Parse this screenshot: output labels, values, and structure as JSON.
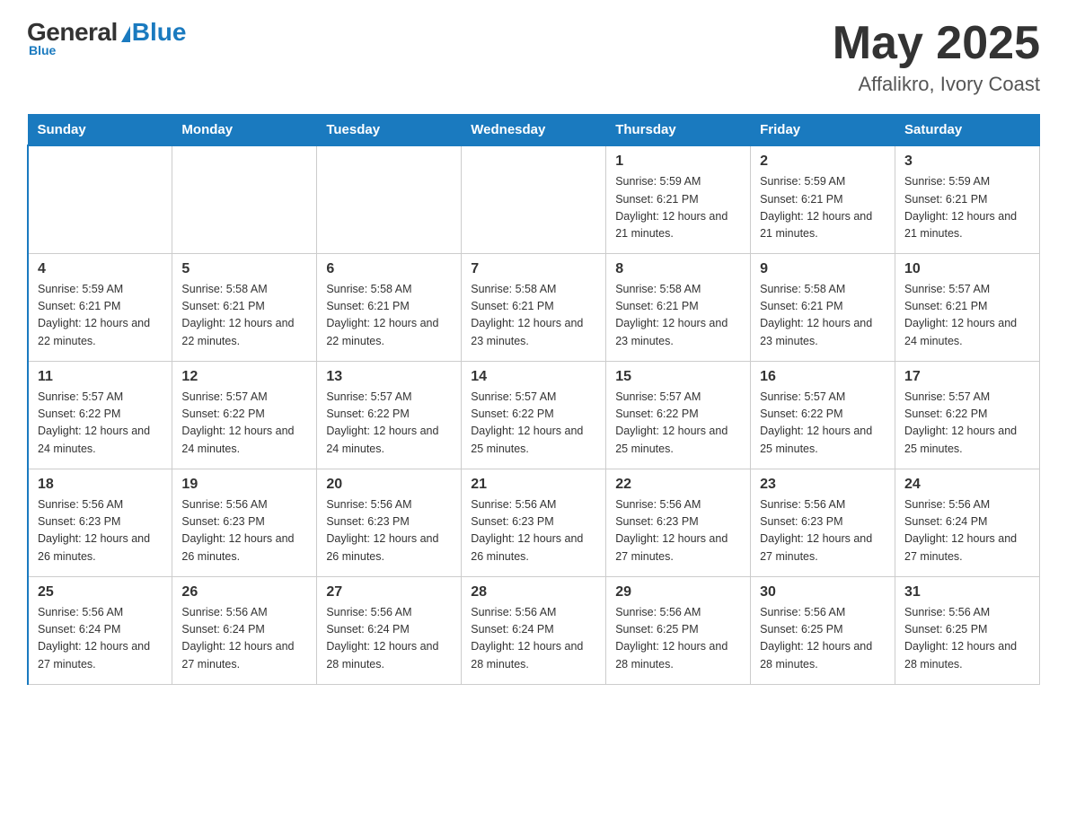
{
  "header": {
    "logo_general": "General",
    "logo_blue": "Blue",
    "logo_sub": "Blue",
    "month_year": "May 2025",
    "location": "Affalikro, Ivory Coast"
  },
  "days_of_week": [
    "Sunday",
    "Monday",
    "Tuesday",
    "Wednesday",
    "Thursday",
    "Friday",
    "Saturday"
  ],
  "weeks": [
    {
      "days": [
        {
          "num": "",
          "info": ""
        },
        {
          "num": "",
          "info": ""
        },
        {
          "num": "",
          "info": ""
        },
        {
          "num": "",
          "info": ""
        },
        {
          "num": "1",
          "info": "Sunrise: 5:59 AM\nSunset: 6:21 PM\nDaylight: 12 hours and 21 minutes."
        },
        {
          "num": "2",
          "info": "Sunrise: 5:59 AM\nSunset: 6:21 PM\nDaylight: 12 hours and 21 minutes."
        },
        {
          "num": "3",
          "info": "Sunrise: 5:59 AM\nSunset: 6:21 PM\nDaylight: 12 hours and 21 minutes."
        }
      ]
    },
    {
      "days": [
        {
          "num": "4",
          "info": "Sunrise: 5:59 AM\nSunset: 6:21 PM\nDaylight: 12 hours and 22 minutes."
        },
        {
          "num": "5",
          "info": "Sunrise: 5:58 AM\nSunset: 6:21 PM\nDaylight: 12 hours and 22 minutes."
        },
        {
          "num": "6",
          "info": "Sunrise: 5:58 AM\nSunset: 6:21 PM\nDaylight: 12 hours and 22 minutes."
        },
        {
          "num": "7",
          "info": "Sunrise: 5:58 AM\nSunset: 6:21 PM\nDaylight: 12 hours and 23 minutes."
        },
        {
          "num": "8",
          "info": "Sunrise: 5:58 AM\nSunset: 6:21 PM\nDaylight: 12 hours and 23 minutes."
        },
        {
          "num": "9",
          "info": "Sunrise: 5:58 AM\nSunset: 6:21 PM\nDaylight: 12 hours and 23 minutes."
        },
        {
          "num": "10",
          "info": "Sunrise: 5:57 AM\nSunset: 6:21 PM\nDaylight: 12 hours and 24 minutes."
        }
      ]
    },
    {
      "days": [
        {
          "num": "11",
          "info": "Sunrise: 5:57 AM\nSunset: 6:22 PM\nDaylight: 12 hours and 24 minutes."
        },
        {
          "num": "12",
          "info": "Sunrise: 5:57 AM\nSunset: 6:22 PM\nDaylight: 12 hours and 24 minutes."
        },
        {
          "num": "13",
          "info": "Sunrise: 5:57 AM\nSunset: 6:22 PM\nDaylight: 12 hours and 24 minutes."
        },
        {
          "num": "14",
          "info": "Sunrise: 5:57 AM\nSunset: 6:22 PM\nDaylight: 12 hours and 25 minutes."
        },
        {
          "num": "15",
          "info": "Sunrise: 5:57 AM\nSunset: 6:22 PM\nDaylight: 12 hours and 25 minutes."
        },
        {
          "num": "16",
          "info": "Sunrise: 5:57 AM\nSunset: 6:22 PM\nDaylight: 12 hours and 25 minutes."
        },
        {
          "num": "17",
          "info": "Sunrise: 5:57 AM\nSunset: 6:22 PM\nDaylight: 12 hours and 25 minutes."
        }
      ]
    },
    {
      "days": [
        {
          "num": "18",
          "info": "Sunrise: 5:56 AM\nSunset: 6:23 PM\nDaylight: 12 hours and 26 minutes."
        },
        {
          "num": "19",
          "info": "Sunrise: 5:56 AM\nSunset: 6:23 PM\nDaylight: 12 hours and 26 minutes."
        },
        {
          "num": "20",
          "info": "Sunrise: 5:56 AM\nSunset: 6:23 PM\nDaylight: 12 hours and 26 minutes."
        },
        {
          "num": "21",
          "info": "Sunrise: 5:56 AM\nSunset: 6:23 PM\nDaylight: 12 hours and 26 minutes."
        },
        {
          "num": "22",
          "info": "Sunrise: 5:56 AM\nSunset: 6:23 PM\nDaylight: 12 hours and 27 minutes."
        },
        {
          "num": "23",
          "info": "Sunrise: 5:56 AM\nSunset: 6:23 PM\nDaylight: 12 hours and 27 minutes."
        },
        {
          "num": "24",
          "info": "Sunrise: 5:56 AM\nSunset: 6:24 PM\nDaylight: 12 hours and 27 minutes."
        }
      ]
    },
    {
      "days": [
        {
          "num": "25",
          "info": "Sunrise: 5:56 AM\nSunset: 6:24 PM\nDaylight: 12 hours and 27 minutes."
        },
        {
          "num": "26",
          "info": "Sunrise: 5:56 AM\nSunset: 6:24 PM\nDaylight: 12 hours and 27 minutes."
        },
        {
          "num": "27",
          "info": "Sunrise: 5:56 AM\nSunset: 6:24 PM\nDaylight: 12 hours and 28 minutes."
        },
        {
          "num": "28",
          "info": "Sunrise: 5:56 AM\nSunset: 6:24 PM\nDaylight: 12 hours and 28 minutes."
        },
        {
          "num": "29",
          "info": "Sunrise: 5:56 AM\nSunset: 6:25 PM\nDaylight: 12 hours and 28 minutes."
        },
        {
          "num": "30",
          "info": "Sunrise: 5:56 AM\nSunset: 6:25 PM\nDaylight: 12 hours and 28 minutes."
        },
        {
          "num": "31",
          "info": "Sunrise: 5:56 AM\nSunset: 6:25 PM\nDaylight: 12 hours and 28 minutes."
        }
      ]
    }
  ]
}
